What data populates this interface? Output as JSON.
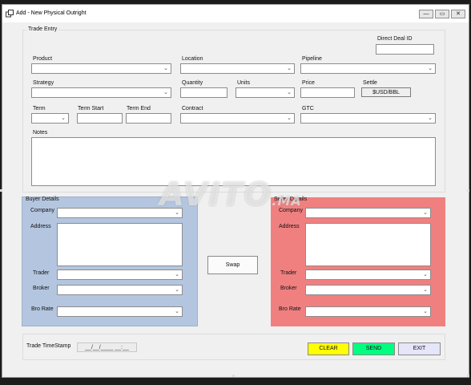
{
  "window": {
    "title": "Add - New Physical Outright",
    "minimize_glyph": "—",
    "maximize_glyph": "▭",
    "close_glyph": "✕",
    "app_icon": "window-icon"
  },
  "trade_entry": {
    "group_label": "Trade Entry",
    "direct_deal_id_label": "Direct Deal ID",
    "product_label": "Product",
    "location_label": "Location",
    "pipeline_label": "Pipeline",
    "strategy_label": "Strategy",
    "quantity_label": "Quantity",
    "units_label": "Units",
    "price_label": "Price",
    "settle_label": "Settle",
    "settle_value": "$USD/BBL",
    "term_label": "Term",
    "term_start_label": "Term Start",
    "term_end_label": "Term End",
    "contract_label": "Contract",
    "gtc_label": "GTC",
    "notes_label": "Notes"
  },
  "buyer": {
    "group_label": "Buyer Details",
    "company_label": "Company",
    "address_label": "Address",
    "trader_label": "Trader",
    "broker_label": "Broker",
    "bro_rate_label": "Bro Rate",
    "color": "#b4c6df"
  },
  "seller": {
    "group_label": "Seller Details",
    "company_label": "Company",
    "address_label": "Address",
    "trader_label": "Trader",
    "broker_label": "Broker",
    "bro_rate_label": "Bro Rate",
    "color": "#f08080"
  },
  "swap_label": "Swap",
  "timestamp": {
    "label": "Trade TimeStamp",
    "value": "__/__/____ __:__"
  },
  "actions": {
    "clear_label": "CLEAR",
    "send_label": "SEND",
    "exit_label": "EXIT",
    "clear_color": "#ffff00",
    "send_color": "#00ff7f",
    "exit_color": "#e6e6fa"
  },
  "watermark": {
    "text": "AVITO",
    "suffix": ".MA"
  }
}
